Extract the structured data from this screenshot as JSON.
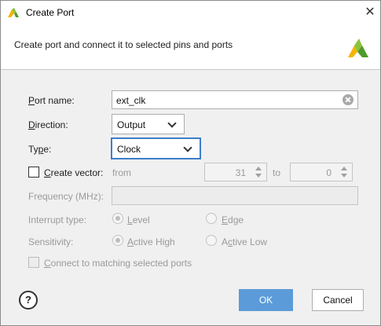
{
  "window": {
    "title": "Create Port",
    "close_glyph": "✕"
  },
  "header": {
    "description": "Create port and connect it to selected pins and ports",
    "logo": "vivado-logo-icon"
  },
  "form": {
    "port_name": {
      "label_u": "P",
      "label_rest": "ort name:",
      "value": "ext_clk"
    },
    "direction": {
      "label_u": "D",
      "label_rest": "irection:",
      "value": "Output"
    },
    "type": {
      "label_pre": "Ty",
      "label_u": "p",
      "label_rest": "e:",
      "value": "Clock"
    },
    "create_vector": {
      "label_u": "C",
      "label_rest": "reate vector:",
      "checked": false,
      "from_label": "from",
      "from_value": "31",
      "to_label": "to",
      "to_value": "0"
    },
    "frequency": {
      "label": "Frequency (MHz):",
      "value": ""
    },
    "interrupt_type": {
      "label": "Interrupt type:",
      "option1_u": "L",
      "option1_rest": "evel",
      "option2_u": "E",
      "option2_rest": "dge"
    },
    "sensitivity": {
      "label": "Sensitivity:",
      "option1_u": "A",
      "option1_rest": "ctive High",
      "option2_pre": "A",
      "option2_u": "c",
      "option2_rest": "tive Low"
    },
    "connect_matching": {
      "label_u": "C",
      "label_rest": "onnect to matching selected ports",
      "checked": false
    }
  },
  "footer": {
    "help_glyph": "?",
    "ok_label": "OK",
    "cancel_label": "Cancel"
  },
  "colors": {
    "accent": "#5c9bd9",
    "focus_border": "#3c7fc9"
  }
}
